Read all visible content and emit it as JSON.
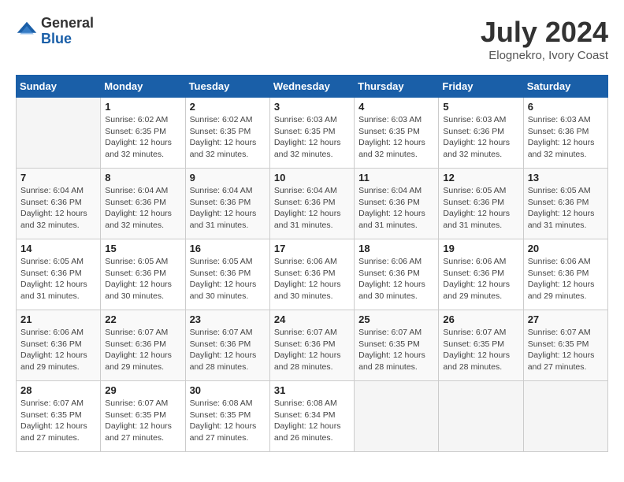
{
  "header": {
    "logo_general": "General",
    "logo_blue": "Blue",
    "month_year": "July 2024",
    "location": "Elognekro, Ivory Coast"
  },
  "days_of_week": [
    "Sunday",
    "Monday",
    "Tuesday",
    "Wednesday",
    "Thursday",
    "Friday",
    "Saturday"
  ],
  "weeks": [
    [
      {
        "day": "",
        "info": ""
      },
      {
        "day": "1",
        "info": "Sunrise: 6:02 AM\nSunset: 6:35 PM\nDaylight: 12 hours\nand 32 minutes."
      },
      {
        "day": "2",
        "info": "Sunrise: 6:02 AM\nSunset: 6:35 PM\nDaylight: 12 hours\nand 32 minutes."
      },
      {
        "day": "3",
        "info": "Sunrise: 6:03 AM\nSunset: 6:35 PM\nDaylight: 12 hours\nand 32 minutes."
      },
      {
        "day": "4",
        "info": "Sunrise: 6:03 AM\nSunset: 6:35 PM\nDaylight: 12 hours\nand 32 minutes."
      },
      {
        "day": "5",
        "info": "Sunrise: 6:03 AM\nSunset: 6:36 PM\nDaylight: 12 hours\nand 32 minutes."
      },
      {
        "day": "6",
        "info": "Sunrise: 6:03 AM\nSunset: 6:36 PM\nDaylight: 12 hours\nand 32 minutes."
      }
    ],
    [
      {
        "day": "7",
        "info": "Sunrise: 6:04 AM\nSunset: 6:36 PM\nDaylight: 12 hours\nand 32 minutes."
      },
      {
        "day": "8",
        "info": "Sunrise: 6:04 AM\nSunset: 6:36 PM\nDaylight: 12 hours\nand 32 minutes."
      },
      {
        "day": "9",
        "info": "Sunrise: 6:04 AM\nSunset: 6:36 PM\nDaylight: 12 hours\nand 31 minutes."
      },
      {
        "day": "10",
        "info": "Sunrise: 6:04 AM\nSunset: 6:36 PM\nDaylight: 12 hours\nand 31 minutes."
      },
      {
        "day": "11",
        "info": "Sunrise: 6:04 AM\nSunset: 6:36 PM\nDaylight: 12 hours\nand 31 minutes."
      },
      {
        "day": "12",
        "info": "Sunrise: 6:05 AM\nSunset: 6:36 PM\nDaylight: 12 hours\nand 31 minutes."
      },
      {
        "day": "13",
        "info": "Sunrise: 6:05 AM\nSunset: 6:36 PM\nDaylight: 12 hours\nand 31 minutes."
      }
    ],
    [
      {
        "day": "14",
        "info": "Sunrise: 6:05 AM\nSunset: 6:36 PM\nDaylight: 12 hours\nand 31 minutes."
      },
      {
        "day": "15",
        "info": "Sunrise: 6:05 AM\nSunset: 6:36 PM\nDaylight: 12 hours\nand 30 minutes."
      },
      {
        "day": "16",
        "info": "Sunrise: 6:05 AM\nSunset: 6:36 PM\nDaylight: 12 hours\nand 30 minutes."
      },
      {
        "day": "17",
        "info": "Sunrise: 6:06 AM\nSunset: 6:36 PM\nDaylight: 12 hours\nand 30 minutes."
      },
      {
        "day": "18",
        "info": "Sunrise: 6:06 AM\nSunset: 6:36 PM\nDaylight: 12 hours\nand 30 minutes."
      },
      {
        "day": "19",
        "info": "Sunrise: 6:06 AM\nSunset: 6:36 PM\nDaylight: 12 hours\nand 29 minutes."
      },
      {
        "day": "20",
        "info": "Sunrise: 6:06 AM\nSunset: 6:36 PM\nDaylight: 12 hours\nand 29 minutes."
      }
    ],
    [
      {
        "day": "21",
        "info": "Sunrise: 6:06 AM\nSunset: 6:36 PM\nDaylight: 12 hours\nand 29 minutes."
      },
      {
        "day": "22",
        "info": "Sunrise: 6:07 AM\nSunset: 6:36 PM\nDaylight: 12 hours\nand 29 minutes."
      },
      {
        "day": "23",
        "info": "Sunrise: 6:07 AM\nSunset: 6:36 PM\nDaylight: 12 hours\nand 28 minutes."
      },
      {
        "day": "24",
        "info": "Sunrise: 6:07 AM\nSunset: 6:36 PM\nDaylight: 12 hours\nand 28 minutes."
      },
      {
        "day": "25",
        "info": "Sunrise: 6:07 AM\nSunset: 6:35 PM\nDaylight: 12 hours\nand 28 minutes."
      },
      {
        "day": "26",
        "info": "Sunrise: 6:07 AM\nSunset: 6:35 PM\nDaylight: 12 hours\nand 28 minutes."
      },
      {
        "day": "27",
        "info": "Sunrise: 6:07 AM\nSunset: 6:35 PM\nDaylight: 12 hours\nand 27 minutes."
      }
    ],
    [
      {
        "day": "28",
        "info": "Sunrise: 6:07 AM\nSunset: 6:35 PM\nDaylight: 12 hours\nand 27 minutes."
      },
      {
        "day": "29",
        "info": "Sunrise: 6:07 AM\nSunset: 6:35 PM\nDaylight: 12 hours\nand 27 minutes."
      },
      {
        "day": "30",
        "info": "Sunrise: 6:08 AM\nSunset: 6:35 PM\nDaylight: 12 hours\nand 27 minutes."
      },
      {
        "day": "31",
        "info": "Sunrise: 6:08 AM\nSunset: 6:34 PM\nDaylight: 12 hours\nand 26 minutes."
      },
      {
        "day": "",
        "info": ""
      },
      {
        "day": "",
        "info": ""
      },
      {
        "day": "",
        "info": ""
      }
    ]
  ]
}
